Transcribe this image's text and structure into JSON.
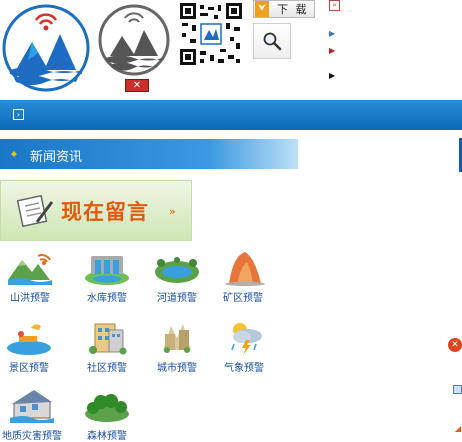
{
  "header": {
    "download_label": "下 载",
    "download_icon": "chevron-down-icon"
  },
  "nav_bar": {
    "icon": "expand-box-icon"
  },
  "news": {
    "title": "新闻资讯"
  },
  "message_banner": {
    "label": "现在留言",
    "chevron": "»"
  },
  "warnings": [
    {
      "label": "山洪预警",
      "icon": "mountain-flood-icon"
    },
    {
      "label": "水库预警",
      "icon": "reservoir-icon"
    },
    {
      "label": "河道预警",
      "icon": "river-icon"
    },
    {
      "label": "矿区预警",
      "icon": "mine-icon"
    },
    {
      "label": "景区预警",
      "icon": "scenic-area-icon"
    },
    {
      "label": "社区预警",
      "icon": "community-icon"
    },
    {
      "label": "城市预警",
      "icon": "city-icon"
    },
    {
      "label": "气象预警",
      "icon": "weather-icon"
    },
    {
      "label": "地质灾害预警",
      "icon": "geological-disaster-icon"
    },
    {
      "label": "森林预警",
      "icon": "forest-icon"
    }
  ],
  "colors": {
    "brand_blue": "#0a68b8",
    "accent_orange": "#e25a0c",
    "red": "#c9302c"
  }
}
